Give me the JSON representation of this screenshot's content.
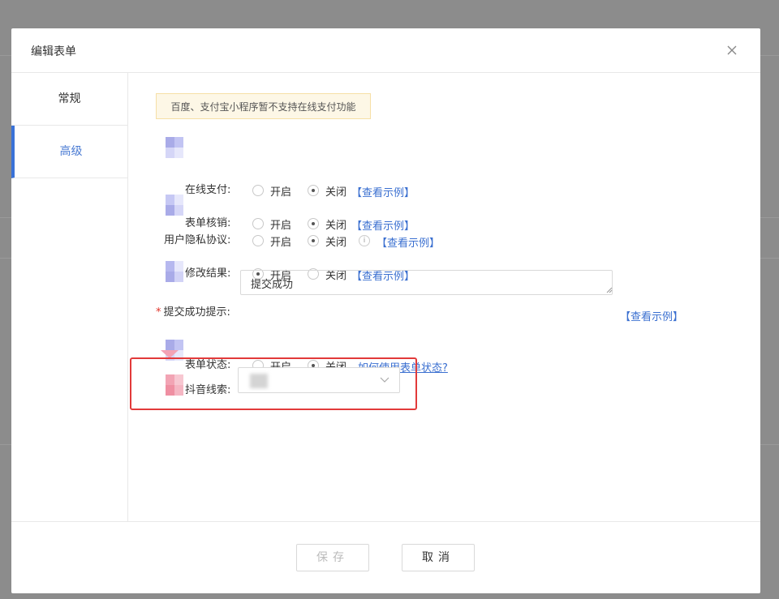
{
  "modal": {
    "title": "编辑表单"
  },
  "sidebar": {
    "tabs": [
      {
        "label": "常规",
        "active": false
      },
      {
        "label": "高级",
        "active": true
      }
    ]
  },
  "notice": "百度、支付宝小程序暂不支持在线支付功能",
  "options": {
    "on": "开启",
    "off": "关闭"
  },
  "fields": {
    "online_payment": {
      "label": "在线支付:",
      "selected": "off",
      "link": "【查看示例】"
    },
    "form_verify": {
      "label": "表单核销:",
      "selected": "off",
      "link": "【查看示例】"
    },
    "privacy": {
      "label": "用户隐私协议:",
      "selected": "off",
      "info": "i",
      "link": "【查看示例】"
    },
    "modify_result": {
      "label": "修改结果:",
      "selected": "on",
      "link": "【查看示例】"
    },
    "success_tip": {
      "label": "提交成功提示:",
      "required": "*",
      "value": "提交成功",
      "link": "【查看示例】"
    },
    "form_status": {
      "label": "表单状态:",
      "selected": "off",
      "link": "如何使用表单状态?"
    },
    "douyin_leads": {
      "label": "抖音线索:"
    }
  },
  "footer": {
    "save_label": "保存",
    "cancel_label": "取消"
  },
  "colors": {
    "accent": "#3a72d8",
    "link": "#3a6fd0",
    "highlight": "#e23a3a",
    "required": "#e0342a"
  }
}
